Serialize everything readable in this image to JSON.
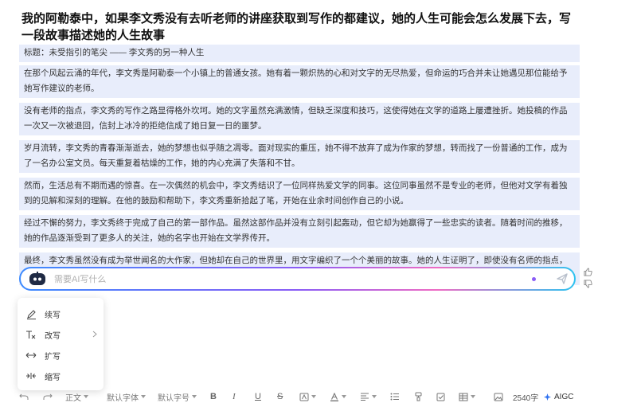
{
  "document": {
    "title": "我的阿勒泰中，如果李文秀没有去听老师的讲座获取到写作的都建议，她的人生可能会怎么发展下去，写一段故事描述她的人生故事",
    "paragraphs": [
      "标题：未受指引的笔尖 —— 李文秀的另一种人生",
      "在那个风起云涌的年代，李文秀是阿勒泰一个小镇上的普通女孩。她有着一颗炽热的心和对文字的无尽热爱，但命运的巧合并未让她遇见那位能给予她写作建议的老师。",
      "没有老师的指点，李文秀的写作之路显得格外坎坷。她的文字虽然充满激情，但缺乏深度和技巧，这使得她在文学的道路上屡遭挫折。她投稿的作品一次又一次被退回，信封上冰冷的拒绝信成了她日复一日的噩梦。",
      "岁月流转，李文秀的青春渐渐逝去，她的梦想也似乎随之凋零。面对现实的重压，她不得不放弃了成为作家的梦想，转而找了一份普通的工作，成为了一名办公室文员。每天重复着枯燥的工作，她的内心充满了失落和不甘。",
      "然而，生活总有不期而遇的惊喜。在一次偶然的机会中，李文秀结识了一位同样热爱文学的同事。这位同事虽然不是专业的老师，但他对文学有着独到的见解和深刻的理解。在他的鼓励和帮助下，李文秀重新拾起了笔，开始在业余时间创作自己的小说。",
      "经过不懈的努力，李文秀终于完成了自己的第一部作品。虽然这部作品并没有立刻引起轰动，但它却为她赢得了一些忠实的读者。随着时间的推移，她的作品逐渐受到了更多人的关注，她的名字也开始在文学界传开。",
      "最终，李文秀虽然没有成为举世闻名的大作家，但她却在自己的世界里，用文字编织了一个个美丽的故事。她的人生证明了，即使没有名师的指点，只要坚持梦想，用心去感受和表达，每个人都能在生活的土壤中，开出属于自己的花朵。"
    ]
  },
  "ai_bar": {
    "placeholder": "需要AI写什么"
  },
  "menu": {
    "items": [
      {
        "label": "续写",
        "icon": "continue-write-icon"
      },
      {
        "label": "改写",
        "icon": "rewrite-icon",
        "has_submenu": true
      },
      {
        "label": "扩写",
        "icon": "expand-icon"
      },
      {
        "label": "缩写",
        "icon": "shrink-icon"
      }
    ]
  },
  "toolbar": {
    "paragraph_style": "正文",
    "font_family": "默认字体",
    "font_size": "默认字号",
    "word_count": "2540字",
    "aigc_label": "AIGC"
  },
  "colors": {
    "paragraph_bg": "#e8edfb",
    "accent": "#8a5cf6",
    "aigc_blue": "#2b6ff0"
  }
}
